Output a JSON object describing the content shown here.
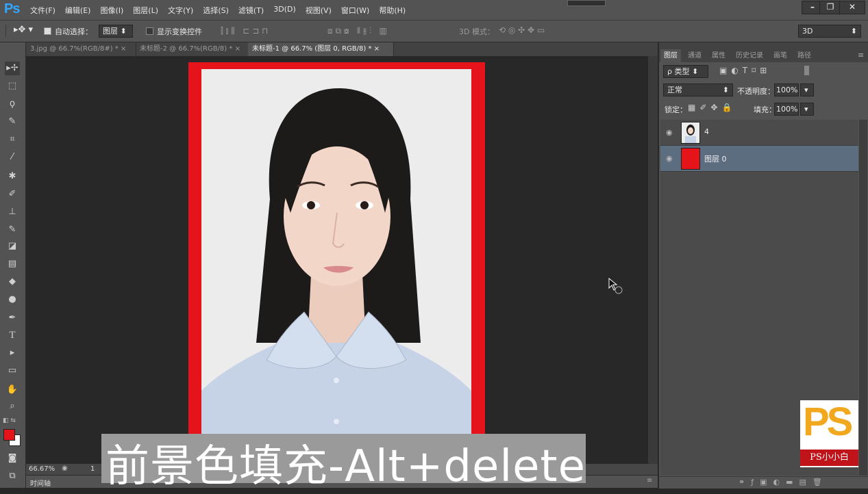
{
  "app": {
    "logo": "Ps"
  },
  "menu": [
    "文件(F)",
    "编辑(E)",
    "图像(I)",
    "图层(L)",
    "文字(Y)",
    "选择(S)",
    "滤镜(T)",
    "3D(D)",
    "视图(V)",
    "窗口(W)",
    "帮助(H)"
  ],
  "window_buttons": {
    "minimize": "–",
    "restore": "❐",
    "close": "✕"
  },
  "options": {
    "auto_select_label": "自动选择：",
    "auto_select_value": "图层",
    "show_transform_label": "显示变换控件",
    "mode_label": "3D 模式：",
    "workspace": "3D"
  },
  "tabs": [
    {
      "label": "3.jpg @ 66.7%(RGB/8#) *",
      "close": "×"
    },
    {
      "label": "未标题-2 @ 66.7%(RGB/8) *",
      "close": "×"
    },
    {
      "label": "未标题-1 @ 66.7% (图层 0, RGB/8) *",
      "close": "×"
    }
  ],
  "status": {
    "zoom": "66.67%",
    "doc": "1"
  },
  "timeline": {
    "label": "时间轴"
  },
  "panel": {
    "tabs": [
      "图层",
      "通道",
      "属性",
      "历史记录",
      "画笔",
      "路径"
    ],
    "filter_label": "ρ 类型",
    "blend_mode": "正常",
    "opacity_label": "不透明度：",
    "opacity_value": "100%",
    "lock_label": "锁定：",
    "fill_label": "填充：",
    "fill_value": "100%",
    "layers": [
      {
        "name": "4",
        "visible": true,
        "selected": false,
        "thumb": "photo"
      },
      {
        "name": "图层 0",
        "visible": true,
        "selected": true,
        "thumb": "#e4141a"
      }
    ]
  },
  "colors": {
    "foreground": "#e4141a",
    "background": "#ffffff",
    "canvas_fill": "#e4141a"
  },
  "subtitle": "前景色填充-Alt+delete",
  "badge": {
    "text": "PS",
    "caption": "PS小小白"
  }
}
